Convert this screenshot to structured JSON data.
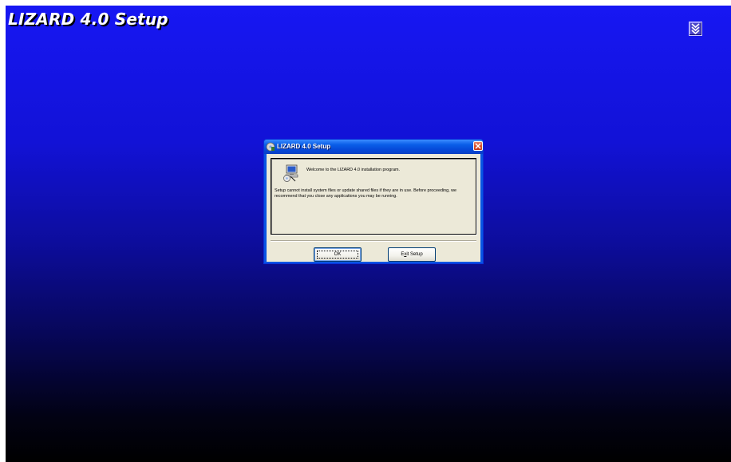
{
  "background": {
    "title": "LIZARD 4.0 Setup",
    "gradient_colors": [
      "#1717f3",
      "#0d0d9c",
      "#000000"
    ],
    "minimize_icon": "chevron-double-down-icon"
  },
  "dialog": {
    "title": "LIZARD 4.0 Setup",
    "title_icon": "setup-disc-icon",
    "close_icon": "close-icon",
    "welcome": "Welcome to the LIZARD 4.0 installation program.",
    "warning": "Setup cannot install system files or update shared files if they are in use. Before proceeding, we recommend that you close any applications you may be running.",
    "ok_label": "OK",
    "exit_label_prefix": "E",
    "exit_label_mnemonic": "x",
    "exit_label_suffix": "it Setup",
    "accent_color": "#0854e3",
    "close_color": "#d9552f"
  }
}
